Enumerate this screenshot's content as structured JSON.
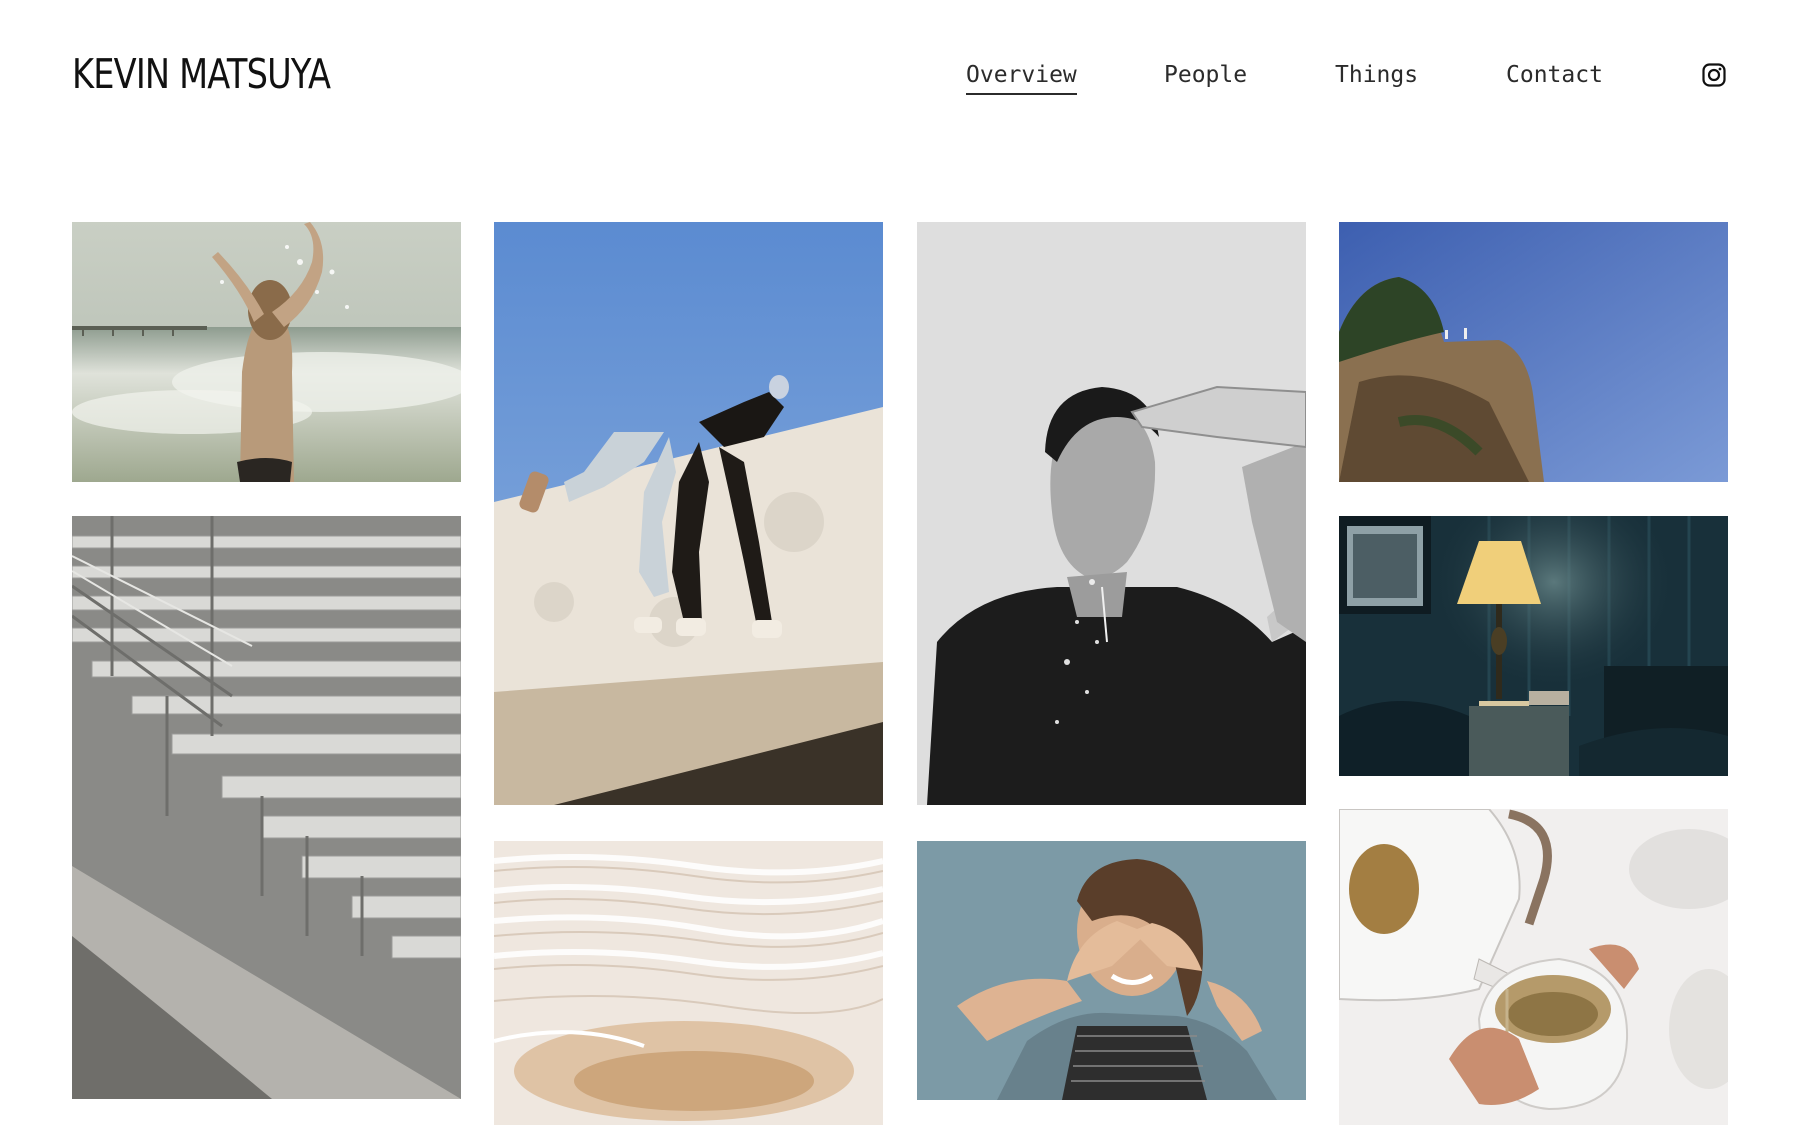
{
  "site": {
    "title": "KEVIN MATSUYA"
  },
  "nav": {
    "items": [
      {
        "label": "Overview",
        "active": true
      },
      {
        "label": "People",
        "active": false
      },
      {
        "label": "Things",
        "active": false
      },
      {
        "label": "Contact",
        "active": false
      }
    ],
    "social_icon": "instagram-icon"
  },
  "gallery": {
    "photos": [
      {
        "subject": "woman-splashing-in-ocean-waves"
      },
      {
        "subject": "two-people-climbing-white-wall"
      },
      {
        "subject": "man-pouring-water-bottle-on-face"
      },
      {
        "subject": "people-on-cliff-top-against-blue-sky"
      },
      {
        "subject": "empty-metal-bleachers"
      },
      {
        "subject": "lamp-on-nightstand-in-dark-room"
      },
      {
        "subject": "white-travertine-terraces"
      },
      {
        "subject": "woman-laughing-covering-eyes"
      },
      {
        "subject": "kettle-pouring-tea-into-cup"
      }
    ]
  },
  "colors": {
    "background": "#ffffff",
    "text": "#111111",
    "nav_text": "#2b2b2b"
  }
}
